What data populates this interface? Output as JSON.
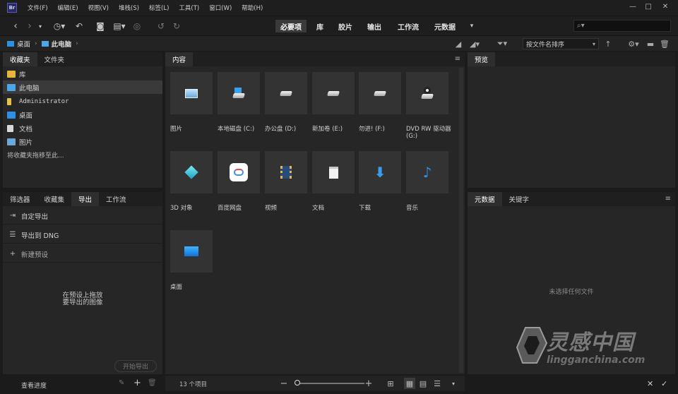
{
  "app": {
    "logo_text": "Br"
  },
  "menu": [
    "文件(F)",
    "编辑(E)",
    "视图(V)",
    "堆栈(S)",
    "标签(L)",
    "工具(T)",
    "窗口(W)",
    "帮助(H)"
  ],
  "window_controls": {
    "minimize": "—",
    "maximize": "□",
    "close": "✕"
  },
  "workspaces": [
    "必要项",
    "库",
    "胶片",
    "输出",
    "工作流",
    "元数据"
  ],
  "workspace_active_index": 0,
  "search": {
    "placeholder": "",
    "icon": "search-icon"
  },
  "breadcrumb": [
    "桌面",
    "此电脑"
  ],
  "sort": {
    "selected": "按文件名排序"
  },
  "favorites_panel": {
    "tabs": [
      "收藏夹",
      "文件夹"
    ],
    "items": [
      {
        "label": "库",
        "icon": "library-folder-icon",
        "color": "#e6b53b"
      },
      {
        "label": "此电脑",
        "icon": "computer-icon",
        "color": "#4aa7e8"
      },
      {
        "label": "Administrator",
        "icon": "user-folder-icon",
        "color": "#e6c24a"
      },
      {
        "label": "桌面",
        "icon": "desktop-folder-icon",
        "color": "#2f8fe0"
      },
      {
        "label": "文档",
        "icon": "document-icon",
        "color": "#d8d8d8"
      },
      {
        "label": "图片",
        "icon": "pictures-icon",
        "color": "#6aa9d9"
      }
    ],
    "drop_hint": "将收藏夹拖移至此..."
  },
  "export_panel": {
    "tabs": [
      "筛选器",
      "收藏集",
      "导出",
      "工作流"
    ],
    "active_tab_index": 2,
    "items": [
      {
        "label": "自定导出",
        "icon": "export-icon"
      },
      {
        "label": "导出到 DNG",
        "icon": "list-icon"
      },
      {
        "label": "新建预设",
        "icon": "plus-icon"
      }
    ],
    "drop_text_1": "在预设上拖放",
    "drop_text_2": "要导出的图像",
    "start_button": "开始导出",
    "progress_link": "查看进度"
  },
  "content_panel": {
    "tab": "内容",
    "tiles": [
      {
        "label": "图片",
        "icon": "pictures-icon"
      },
      {
        "label": "本地磁盘 (C:)",
        "icon": "windows-drive-icon"
      },
      {
        "label": "办公盘 (D:)",
        "icon": "drive-icon"
      },
      {
        "label": "新加卷 (E:)",
        "icon": "drive-icon"
      },
      {
        "label": "勿进! (F:)",
        "icon": "drive-icon"
      },
      {
        "label": "DVD RW 驱动器 (G:)",
        "icon": "dvd-drive-icon"
      },
      {
        "label": "3D 对象",
        "icon": "3d-objects-icon"
      },
      {
        "label": "百度网盘",
        "icon": "baidu-netdisk-icon"
      },
      {
        "label": "视频",
        "icon": "video-icon"
      },
      {
        "label": "文档",
        "icon": "document-icon"
      },
      {
        "label": "下载",
        "icon": "download-icon"
      },
      {
        "label": "音乐",
        "icon": "music-icon"
      },
      {
        "label": "桌面",
        "icon": "desktop-icon"
      }
    ],
    "item_count": "13 个项目"
  },
  "preview_panel": {
    "tab": "预览"
  },
  "metadata_panel": {
    "tabs": [
      "元数据",
      "关键字"
    ],
    "empty_text": "未选择任何文件"
  },
  "watermark": {
    "text": "灵感中国",
    "url": "lingganchina.com"
  }
}
